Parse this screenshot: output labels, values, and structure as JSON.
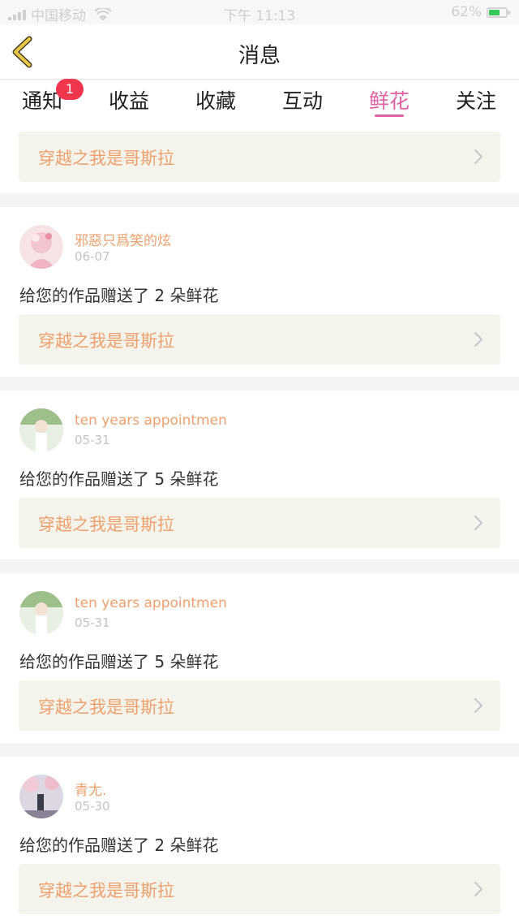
{
  "status_bar": {
    "carrier": "中国移动",
    "time": "下午 11:13",
    "battery": "62%"
  },
  "header": {
    "title": "消息",
    "back_icon": "chevron-left-icon"
  },
  "tabs": [
    {
      "label": "通知",
      "badge": "1"
    },
    {
      "label": "收益"
    },
    {
      "label": "收藏"
    },
    {
      "label": "互动"
    },
    {
      "label": "鲜花",
      "active": true
    },
    {
      "label": "关注"
    }
  ],
  "top_work": {
    "title": "穿越之我是哥斯拉"
  },
  "items": [
    {
      "user": "邪惡只爲笑的炫",
      "date": "06-07",
      "message": "给您的作品赠送了 2 朵鲜花",
      "work": "穿越之我是哥斯拉"
    },
    {
      "user": "ten years appointmen",
      "date": "05-31",
      "message": "给您的作品赠送了 5 朵鲜花",
      "work": "穿越之我是哥斯拉"
    },
    {
      "user": "ten years appointmen",
      "date": "05-31",
      "message": "给您的作品赠送了 5 朵鲜花",
      "work": "穿越之我是哥斯拉"
    },
    {
      "user": "青尢.",
      "date": "05-30",
      "message": "给您的作品赠送了 2 朵鲜花",
      "work": "穿越之我是哥斯拉"
    }
  ],
  "colors": {
    "accent": "#e062a2",
    "name": "#f0a06d",
    "badge": "#f0364d",
    "back": "#e9c64a"
  }
}
